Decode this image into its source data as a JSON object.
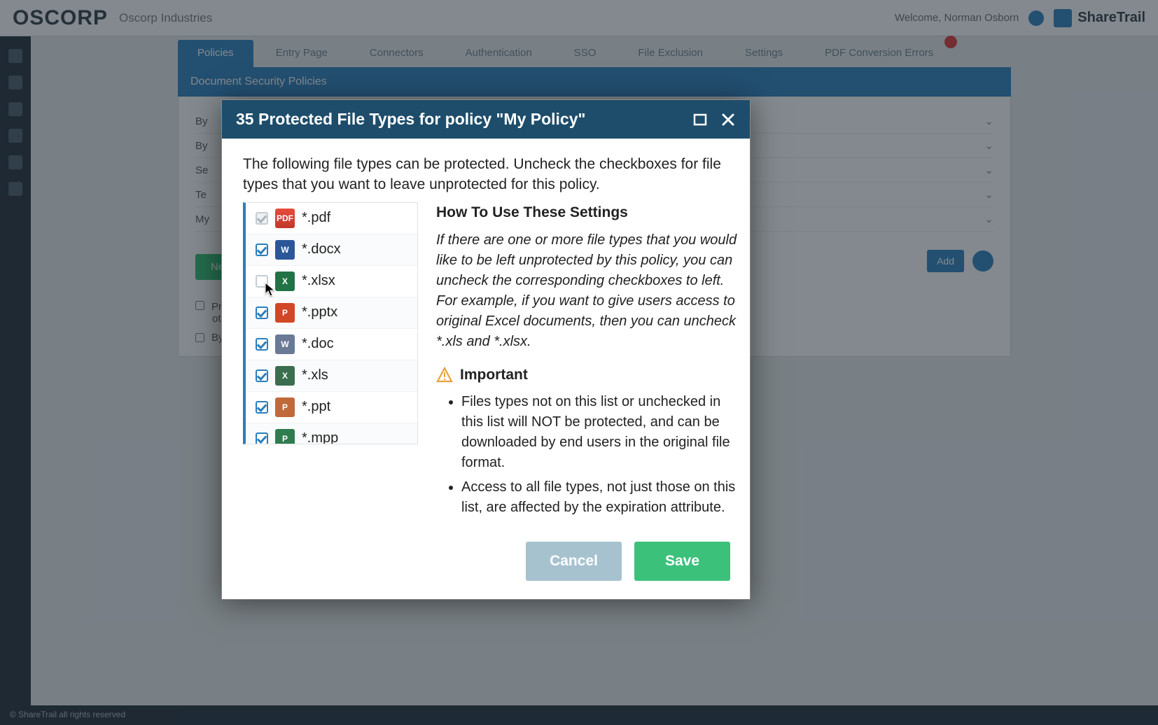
{
  "header": {
    "logo": "OSCORP",
    "company": "Oscorp Industries",
    "welcome": "Welcome, Norman Osborn",
    "brand_right": "ShareTrail"
  },
  "tabs": [
    {
      "label": "Policies",
      "active": true
    },
    {
      "label": "Entry Page",
      "active": false
    },
    {
      "label": "Connectors",
      "active": false
    },
    {
      "label": "Authentication",
      "active": false
    },
    {
      "label": "SSO",
      "active": false
    },
    {
      "label": "File Exclusion",
      "active": false
    },
    {
      "label": "Settings",
      "active": false
    },
    {
      "label": "PDF Conversion Errors",
      "active": false,
      "has_badge": true
    }
  ],
  "panel": {
    "title": "Document Security Policies",
    "rows": [
      {
        "label": "By"
      },
      {
        "label": "By"
      },
      {
        "label": "Se"
      },
      {
        "label": "Te"
      },
      {
        "label": "My"
      }
    ],
    "add_button": "Add",
    "new_button": "New",
    "options": [
      "Prevent documents protected by this policy from being opened by",
      "other users",
      "By"
    ]
  },
  "footer": "© ShareTrail all rights reserved",
  "modal": {
    "title": "35 Protected File Types for policy \"My Policy\"",
    "description": "The following file types can be protected. Uncheck the checkboxes for file types that you want to leave unprotected for this policy.",
    "file_types": [
      {
        "ext": "*.pdf",
        "checked": true,
        "locked": true,
        "icon": "pdf",
        "icon_letter": "PDF"
      },
      {
        "ext": "*.docx",
        "checked": true,
        "locked": false,
        "icon": "docx",
        "icon_letter": "W"
      },
      {
        "ext": "*.xlsx",
        "checked": false,
        "locked": false,
        "icon": "xlsx",
        "icon_letter": "X"
      },
      {
        "ext": "*.pptx",
        "checked": true,
        "locked": false,
        "icon": "pptx",
        "icon_letter": "P"
      },
      {
        "ext": "*.doc",
        "checked": true,
        "locked": false,
        "icon": "doc",
        "icon_letter": "W"
      },
      {
        "ext": "*.xls",
        "checked": true,
        "locked": false,
        "icon": "xls",
        "icon_letter": "X"
      },
      {
        "ext": "*.ppt",
        "checked": true,
        "locked": false,
        "icon": "ppt",
        "icon_letter": "P"
      },
      {
        "ext": "*.mpp",
        "checked": true,
        "locked": false,
        "icon": "mpp",
        "icon_letter": "P"
      }
    ],
    "help": {
      "heading": "How To Use These Settings",
      "body": "If there are one or more file types that you would like to be left unprotected by this policy, you can uncheck the corresponding checkboxes to left. For example, if you want to give users access to original Excel documents, then you can uncheck *.xls and *.xlsx.",
      "important_label": "Important",
      "bullets": [
        "Files types not on this list or unchecked in this list will NOT be protected, and can be downloaded by end users in the original file format.",
        "Access to all file types, not just those on this list, are affected by the expiration attribute."
      ]
    },
    "cancel": "Cancel",
    "save": "Save"
  }
}
